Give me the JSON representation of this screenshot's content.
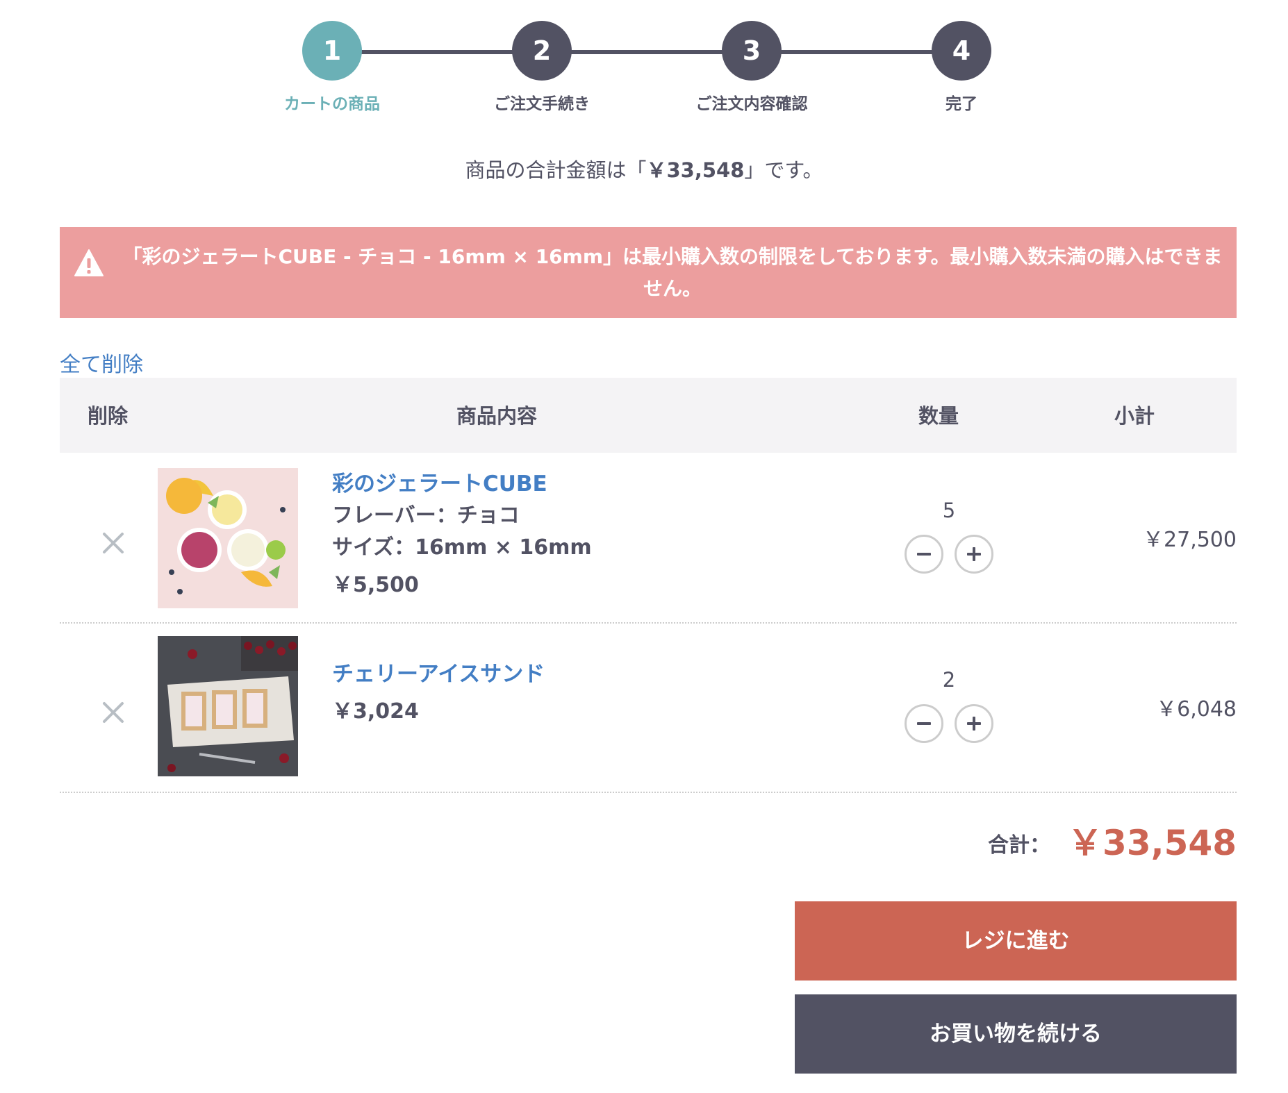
{
  "steps": [
    {
      "number": "1",
      "label": "カートの商品"
    },
    {
      "number": "2",
      "label": "ご注文手続き"
    },
    {
      "number": "3",
      "label": "ご注文内容確認"
    },
    {
      "number": "4",
      "label": "完了"
    }
  ],
  "total_message": {
    "prefix": "商品の合計金額は「",
    "amount": "￥33,548",
    "suffix": "」です。"
  },
  "alert": {
    "icon": "warning-icon",
    "text": "「彩のジェラートCUBE - チョコ - 16mm × 16mm」は最小購入数の制限をしております。最小購入数未満の購入はできません。"
  },
  "delete_all_label": "全て削除",
  "table_headers": {
    "remove": "削除",
    "product": "商品内容",
    "quantity": "数量",
    "subtotal": "小計"
  },
  "items": [
    {
      "name": "彩のジェラートCUBE",
      "attr1": "フレーバー：チョコ",
      "attr2": "サイズ：16mm × 16mm",
      "price": "￥5,500",
      "quantity": "5",
      "subtotal": "￥27,500"
    },
    {
      "name": "チェリーアイスサンド",
      "price": "￥3,024",
      "quantity": "2",
      "subtotal": "￥6,048"
    }
  ],
  "grand_total": {
    "label": "合計：",
    "value": "￥33,548"
  },
  "buttons": {
    "checkout": "レジに進む",
    "continue": "お買い物を続ける"
  },
  "colors": {
    "active_step": "#6bb0b6",
    "dark": "#525263",
    "alert_bg": "#ec9e9e",
    "accent": "#cc6554",
    "link": "#437ec4"
  }
}
